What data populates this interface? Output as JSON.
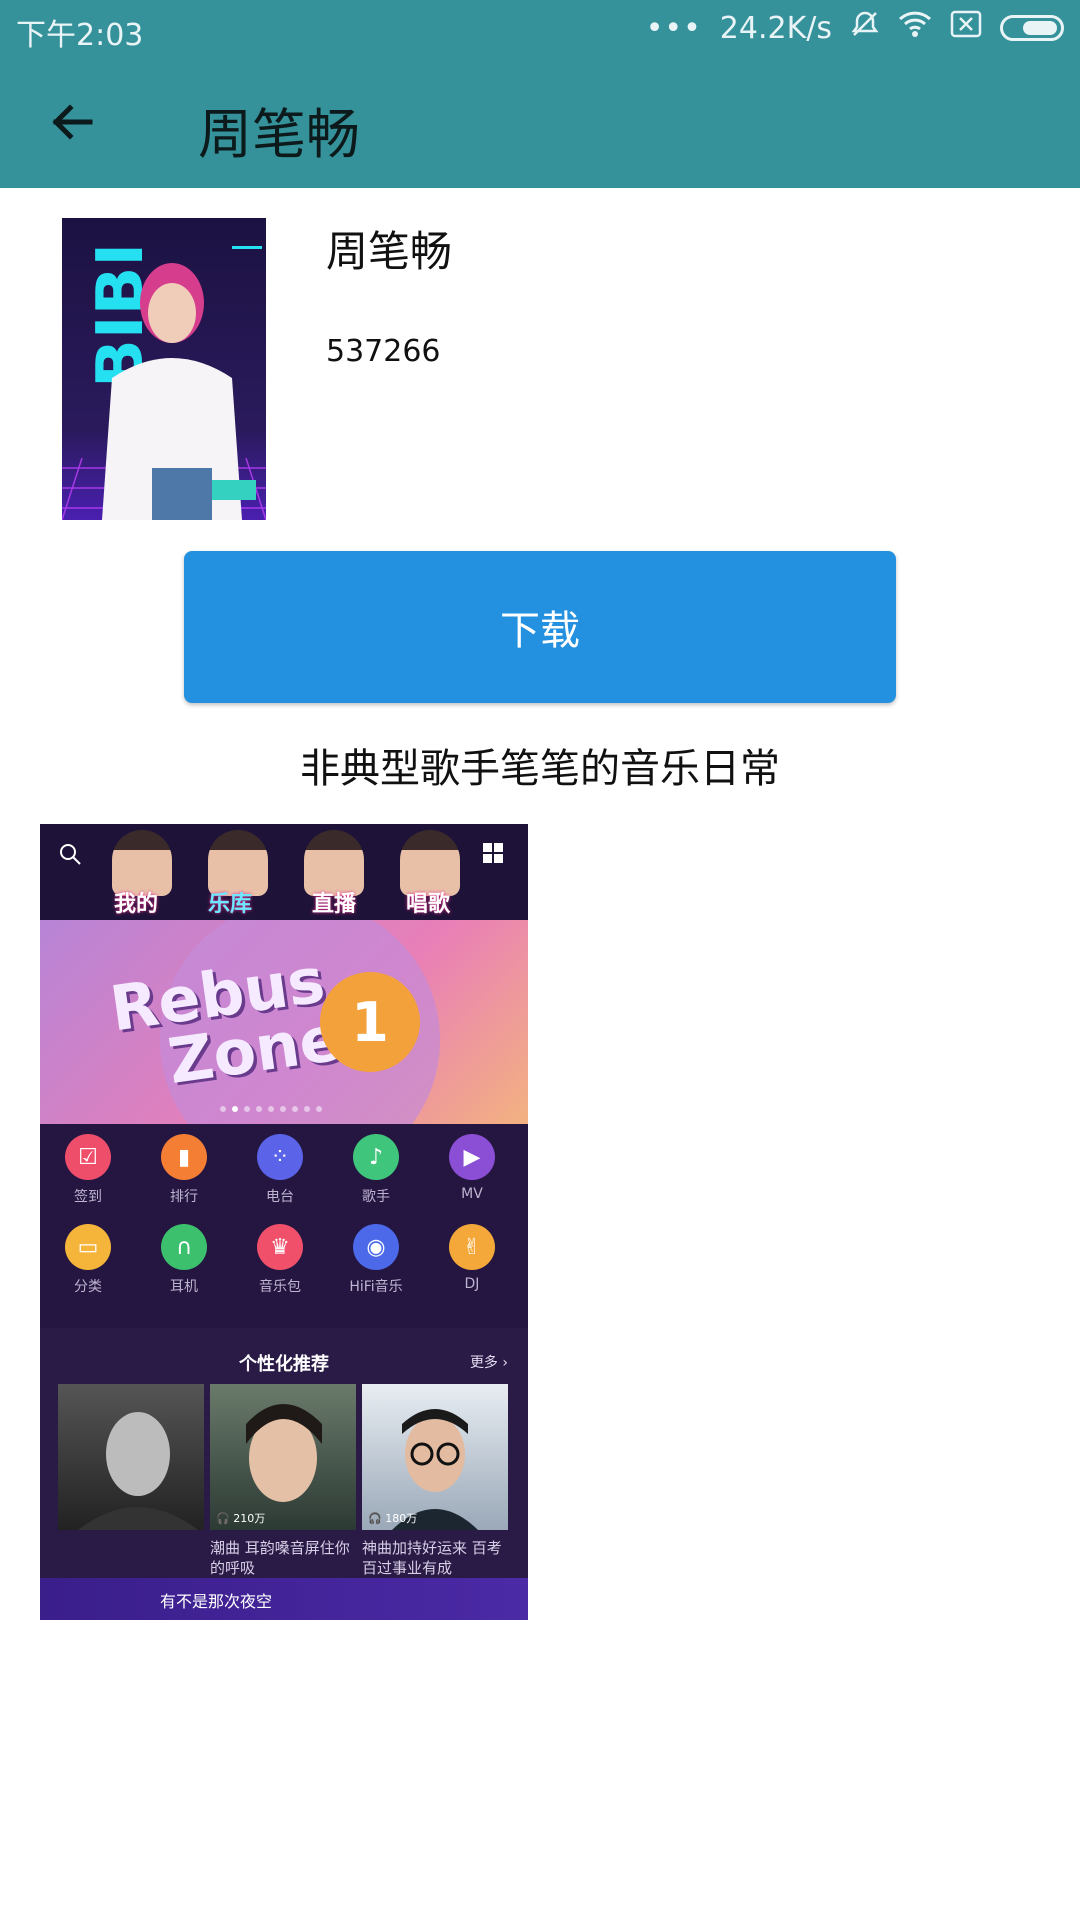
{
  "status_bar": {
    "time": "下午2:03",
    "dots": "•••",
    "speed": "24.2K/s",
    "icons": [
      "mute-icon",
      "wifi-icon",
      "sim-off-icon",
      "battery-icon"
    ]
  },
  "app_bar": {
    "title": "周笔畅",
    "back_icon": "arrow-left-icon"
  },
  "artist": {
    "name": "周笔畅",
    "count": "537266"
  },
  "download_button": {
    "label": "下载",
    "color": "#2391e0"
  },
  "description": "非典型歌手笔笔的音乐日常",
  "screenshot": {
    "tabs": [
      "我的",
      "乐库",
      "直播",
      "唱歌"
    ],
    "banner": {
      "line1": "Rebus",
      "line2": "Zone",
      "badge": "1"
    },
    "grid": [
      {
        "label": "签到",
        "icon": "checkin-icon",
        "color": "#ef4e6b"
      },
      {
        "label": "排行",
        "icon": "rank-icon",
        "color": "#f57e35"
      },
      {
        "label": "电台",
        "icon": "radio-icon",
        "color": "#5b63e8"
      },
      {
        "label": "歌手",
        "icon": "singer-icon",
        "color": "#3fc67c"
      },
      {
        "label": "MV",
        "icon": "play-icon",
        "color": "#8b4fd6"
      },
      {
        "label": "分类",
        "icon": "category-icon",
        "color": "#f5b53a"
      },
      {
        "label": "耳机",
        "icon": "headphones-icon",
        "color": "#3cc06e"
      },
      {
        "label": "音乐包",
        "icon": "crown-icon",
        "color": "#f0506a"
      },
      {
        "label": "HiFi音乐",
        "icon": "hifi-icon",
        "color": "#4b69e8"
      },
      {
        "label": "DJ",
        "icon": "dj-icon",
        "color": "#f5a83a"
      }
    ],
    "recommend": {
      "title": "个性化推荐",
      "more": "更多",
      "cards": [
        {
          "plays": "",
          "caption": ""
        },
        {
          "plays": "210万",
          "caption": "潮曲 耳韵嗓音屏住你的呼吸"
        },
        {
          "plays": "180万",
          "caption": "神曲加持好运来 百考百过事业有成"
        }
      ],
      "footer": "有不是那次夜空"
    }
  }
}
